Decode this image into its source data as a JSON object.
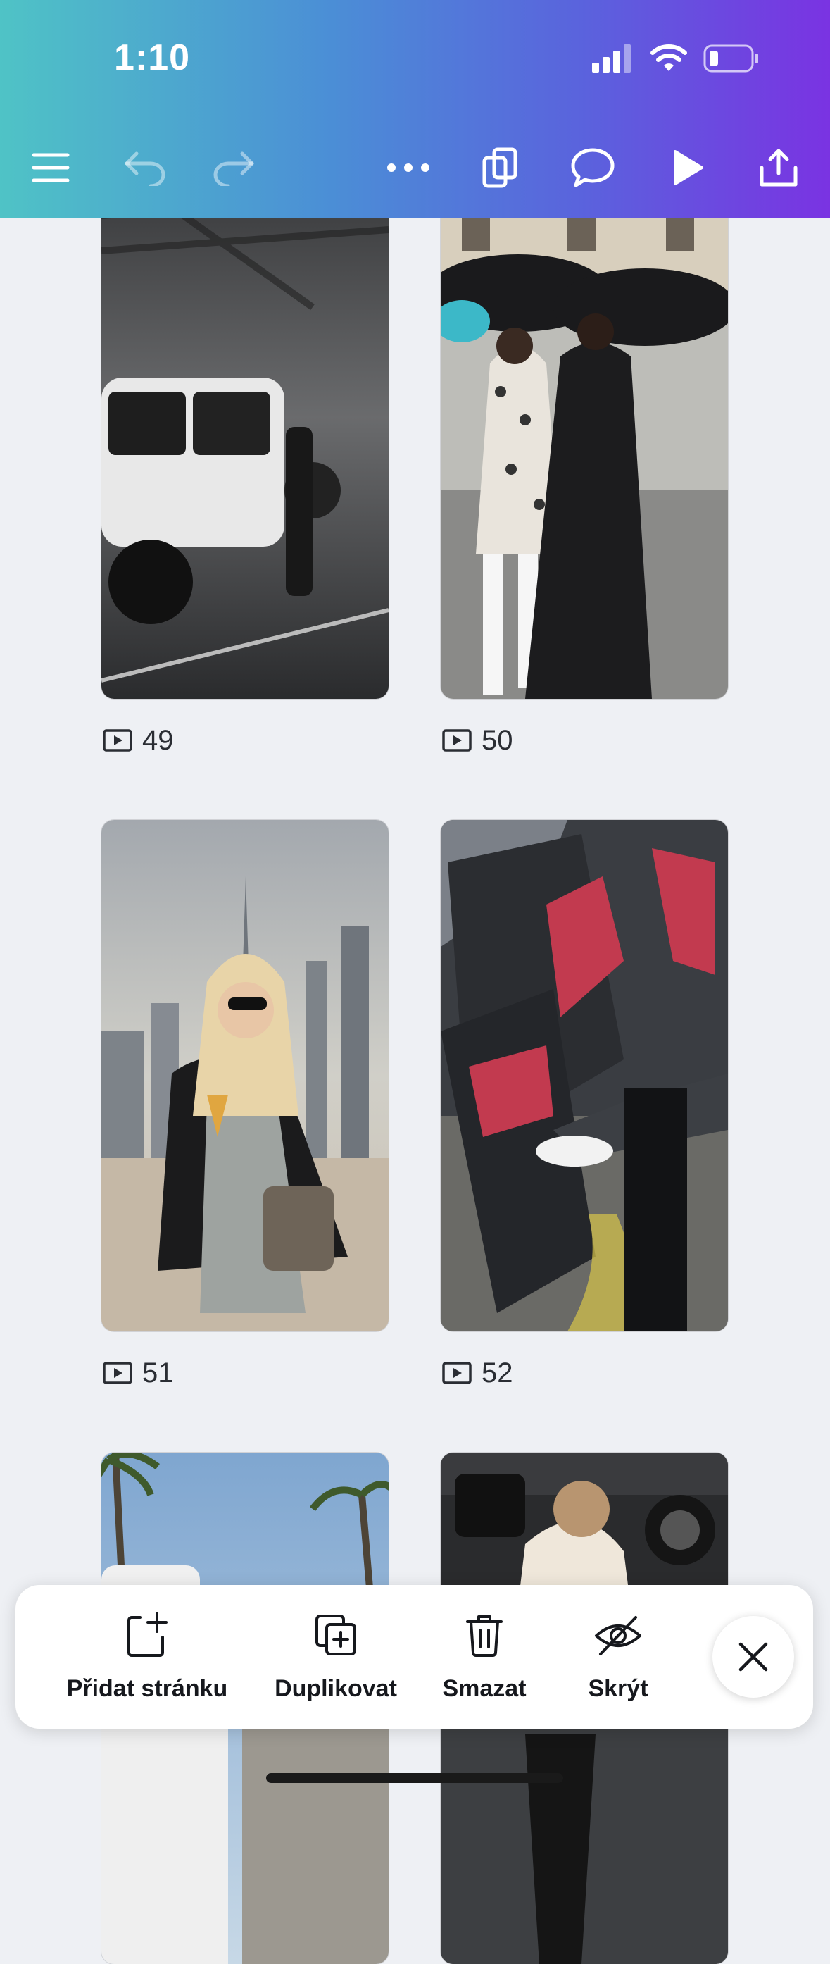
{
  "status_bar": {
    "time": "1:10",
    "icons": [
      "cellular-signal-icon",
      "wifi-icon",
      "battery-icon"
    ]
  },
  "toolbar": {
    "icons": [
      "menu-icon",
      "undo-icon",
      "redo-icon",
      "more-icon",
      "pages-icon",
      "comment-icon",
      "play-icon",
      "share-icon"
    ],
    "undo_enabled": false,
    "redo_enabled": false
  },
  "pages": [
    {
      "number": "49",
      "thumbnail": "white SUV in parking garage"
    },
    {
      "number": "50",
      "thumbnail": "two women with umbrellas"
    },
    {
      "number": "51",
      "thumbnail": "woman with drink at rooftop"
    },
    {
      "number": "52",
      "thumbnail": "car door with red interior"
    },
    {
      "number": "",
      "thumbnail": "palm trees and car"
    },
    {
      "number": "",
      "thumbnail": "woman getting into SUV"
    }
  ],
  "page_icon": "video-page-icon",
  "actions": {
    "add_page": "Přidat stránku",
    "duplicate": "Duplikovat",
    "delete": "Smazat",
    "hide": "Skrýt"
  },
  "colors": {
    "header_gradient_start": "#4fc3c6",
    "header_gradient_end": "#7a33e2",
    "background": "#eef0f4",
    "text": "#16181d"
  }
}
